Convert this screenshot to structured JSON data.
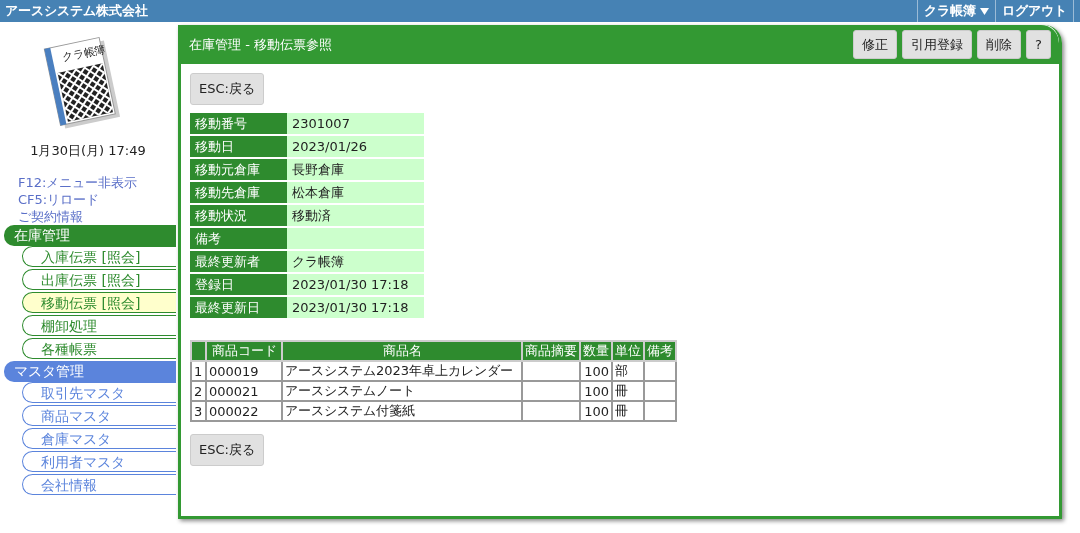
{
  "header": {
    "company": "アースシステム株式会社",
    "user_menu": "クラ帳簿",
    "logout": "ログアウト"
  },
  "sidebar": {
    "logo_text": "クラ帳簿",
    "datetime": "1月30日(月) 17:49",
    "links": [
      "F12:メニュー非表示",
      "CF5:リロード",
      "ご契約情報"
    ],
    "sections": [
      {
        "title": "在庫管理",
        "color": "#2e8b2e",
        "items": [
          {
            "label": "入庫伝票 [照会]",
            "selected": false
          },
          {
            "label": "出庫伝票 [照会]",
            "selected": false
          },
          {
            "label": "移動伝票 [照会]",
            "selected": true
          },
          {
            "label": "棚卸処理",
            "selected": false
          },
          {
            "label": "各種帳票",
            "selected": false
          }
        ]
      },
      {
        "title": "マスタ管理",
        "color": "#5b84dc",
        "items": [
          {
            "label": "取引先マスタ",
            "selected": false
          },
          {
            "label": "商品マスタ",
            "selected": false
          },
          {
            "label": "倉庫マスタ",
            "selected": false
          },
          {
            "label": "利用者マスタ",
            "selected": false
          },
          {
            "label": "会社情報",
            "selected": false
          }
        ]
      }
    ]
  },
  "panel": {
    "title": "在庫管理 - 移動伝票参照",
    "toolbar": [
      "修正",
      "引用登録",
      "削除",
      "?"
    ],
    "back_button": "ESC:戻る",
    "details": [
      {
        "label": "移動番号",
        "value": "2301007"
      },
      {
        "label": "移動日",
        "value": "2023/01/26"
      },
      {
        "label": "移動元倉庫",
        "value": "長野倉庫"
      },
      {
        "label": "移動先倉庫",
        "value": "松本倉庫"
      },
      {
        "label": "移動状況",
        "value": "移動済"
      },
      {
        "label": "備考"
      },
      {
        "label": "最終更新者",
        "value": "クラ帳簿"
      },
      {
        "label": "登録日",
        "value": "2023/01/30 17:18"
      },
      {
        "label": "最終更新日",
        "value": "2023/01/30 17:18"
      }
    ],
    "items_table": {
      "columns": [
        "商品コード",
        "商品名",
        "商品摘要",
        "数量",
        "単位",
        "備考"
      ],
      "rows": [
        {
          "no": "1",
          "code": "000019",
          "name": "アースシステム2023年卓上カレンダー",
          "quantity": "100",
          "unit": "部"
        },
        {
          "no": "2",
          "code": "000021",
          "name": "アースシステムノート",
          "quantity": "100",
          "unit": "冊"
        },
        {
          "no": "3",
          "code": "000022",
          "name": "アースシステム付箋紙",
          "quantity": "100",
          "unit": "冊"
        }
      ]
    },
    "back_button_bottom": "ESC:戻る"
  }
}
